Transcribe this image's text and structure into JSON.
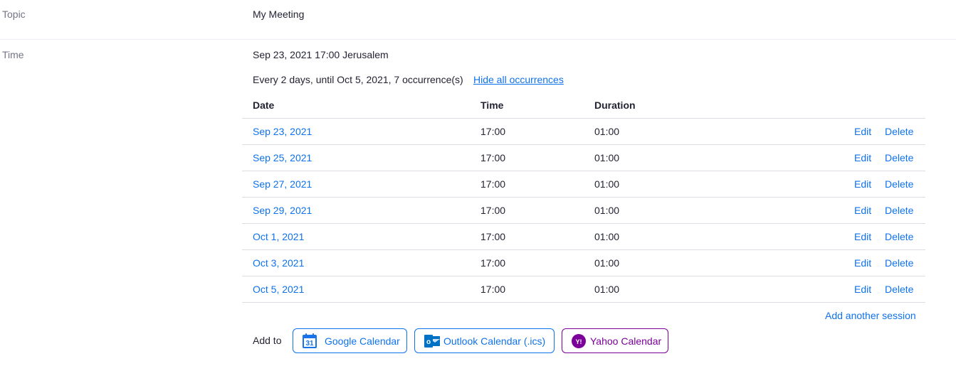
{
  "topic": {
    "label": "Topic",
    "value": "My Meeting"
  },
  "time": {
    "label": "Time",
    "value": "Sep 23, 2021 17:00 Jerusalem",
    "recurrence": "Every 2 days, until Oct 5, 2021, 7 occurrence(s)",
    "hide_link": "Hide all occurrences"
  },
  "occurrences": {
    "headers": {
      "date": "Date",
      "time": "Time",
      "duration": "Duration"
    },
    "rows": [
      {
        "date": "Sep 23, 2021",
        "time": "17:00",
        "duration": "01:00",
        "edit": "Edit",
        "delete": "Delete"
      },
      {
        "date": "Sep 25, 2021",
        "time": "17:00",
        "duration": "01:00",
        "edit": "Edit",
        "delete": "Delete"
      },
      {
        "date": "Sep 27, 2021",
        "time": "17:00",
        "duration": "01:00",
        "edit": "Edit",
        "delete": "Delete"
      },
      {
        "date": "Sep 29, 2021",
        "time": "17:00",
        "duration": "01:00",
        "edit": "Edit",
        "delete": "Delete"
      },
      {
        "date": "Oct 1, 2021",
        "time": "17:00",
        "duration": "01:00",
        "edit": "Edit",
        "delete": "Delete"
      },
      {
        "date": "Oct 3, 2021",
        "time": "17:00",
        "duration": "01:00",
        "edit": "Edit",
        "delete": "Delete"
      },
      {
        "date": "Oct 5, 2021",
        "time": "17:00",
        "duration": "01:00",
        "edit": "Edit",
        "delete": "Delete"
      }
    ],
    "add_session": "Add another session"
  },
  "add_to": {
    "label": "Add to",
    "google": {
      "label": "Google Calendar",
      "icon": "google-calendar-icon",
      "icon_text": "31"
    },
    "outlook": {
      "label": "Outlook Calendar (.ics)",
      "icon": "outlook-icon",
      "icon_text": "o"
    },
    "yahoo": {
      "label": "Yahoo Calendar",
      "icon": "yahoo-icon",
      "icon_text": "Y!"
    }
  },
  "colors": {
    "link": "#0e72ed",
    "yahoo": "#7b0099",
    "label": "#747487",
    "text": "#232333",
    "divider": "#dcdce3"
  }
}
